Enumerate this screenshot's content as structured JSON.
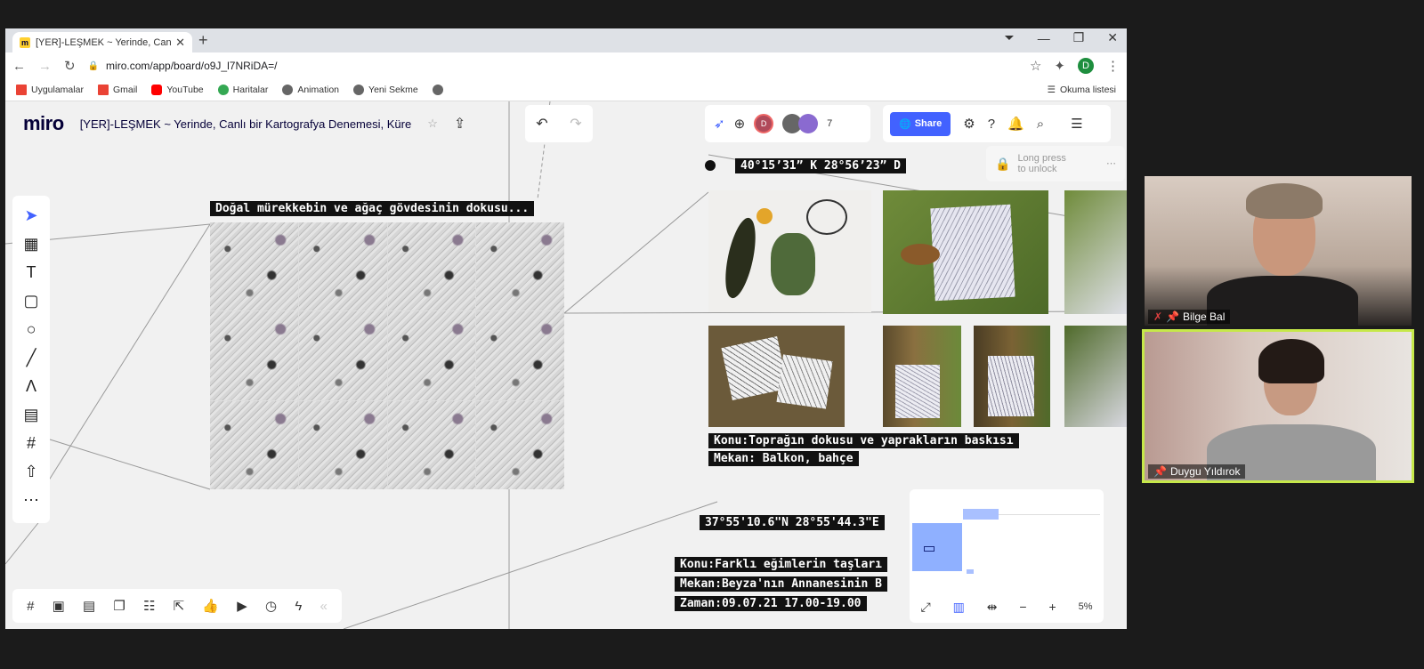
{
  "browser": {
    "tab_title": "[YER]-LEŞMEK ~ Yerinde, Canlı bir...",
    "new_tab": "+",
    "url": "miro.com/app/board/o9J_l7NRiDA=/",
    "bookmarks": [
      {
        "label": "Uygulamalar",
        "icon_color": "#ea4335"
      },
      {
        "label": "Gmail",
        "icon_color": "#ea4335"
      },
      {
        "label": "YouTube",
        "icon_color": "#ff0000"
      },
      {
        "label": "Haritalar",
        "icon_color": "#34a853"
      },
      {
        "label": "Animation",
        "icon_color": "#666666"
      },
      {
        "label": "Yeni Sekme",
        "icon_color": "#666666"
      }
    ],
    "reading_list": "Okuma listesi",
    "profile_initial": "D"
  },
  "miro": {
    "logo": "miro",
    "board_title": "[YER]-LEŞMEK ~ Yerinde, Canlı bir Kartografya Denemesi, Küre",
    "share_label": "Share",
    "collaborator_count": "7",
    "help_badge": "7",
    "avatar_initial": "D",
    "lock_text_1": "Long press",
    "lock_text_2": "to unlock",
    "zoom": "5%",
    "captions": {
      "texture": "Doğal mürekkebin ve ağaç gövdesinin dokusu...",
      "coord1": "40°15’31” K 28°56’23” D",
      "konu1": "Konu:Toprağın dokusu ve yaprakların baskısı",
      "mekan1": "Mekan: Balkon, bahçe",
      "coord2": "37°55'10.6\"N 28°55'44.3\"E",
      "konu2": "Konu:Farklı eğimlerin taşları",
      "mekan2": "Mekan:Beyza'nın Annanesinin B",
      "zaman2": "Zaman:09.07.21 17.00-19.00"
    }
  },
  "participants": [
    {
      "name": "Bilge Bal",
      "muted": true
    },
    {
      "name": "Duygu Yıldırok",
      "muted": false
    }
  ]
}
